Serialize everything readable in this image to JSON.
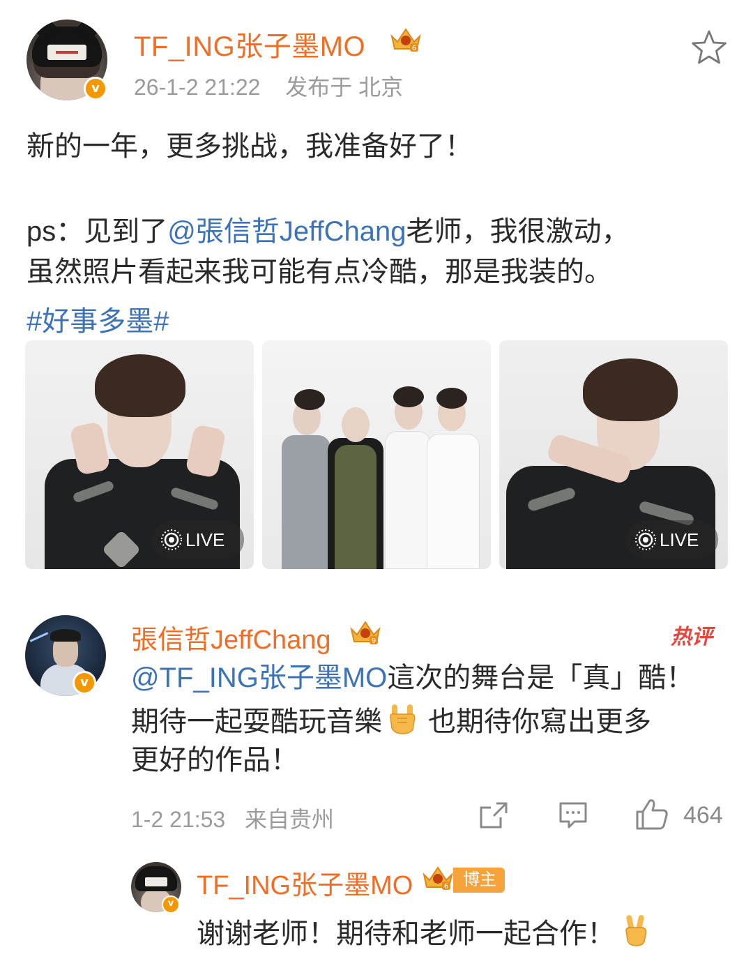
{
  "post": {
    "author": "TF_ING张子墨MO",
    "timestamp": "26-1-2 21:22",
    "location": "发布于 北京",
    "text_line1": "新的一年，更多挑战，我准备好了！",
    "text_line2_prefix": "ps：见到了",
    "text_line2_mention": "@張信哲JeffChang",
    "text_line2_suffix": "老师，我很激动，",
    "text_line3": "虽然照片看起来我可能有点冷酷，那是我装的。",
    "hashtag": "#好事多墨#",
    "photos": [
      {
        "live_label": "LIVE"
      },
      {
        "live_label": ""
      },
      {
        "live_label": "LIVE"
      }
    ]
  },
  "comment": {
    "author": "張信哲JeffChang",
    "hot_tag": "热评",
    "mention": "@TF_ING张子墨MO",
    "text_line1_suffix": "這次的舞台是「真」酷！",
    "text_line2": "期待一起耍酷玩音樂",
    "text_line2_after_emoji": "也期待你寫出更多",
    "text_line3": "更好的作品！",
    "timestamp": "1-2 21:53",
    "source": "来自贵州",
    "like_count": "464"
  },
  "reply": {
    "author": "TF_ING张子墨MO",
    "badge": "博主",
    "text": "谢谢老师！期待和老师一起合作！"
  },
  "colors": {
    "username": "#f26d24",
    "link": "#3b72b8",
    "meta": "#9a9a9a",
    "verified": "#f39800",
    "hot": "#e8453c"
  },
  "icons": {
    "favorite": "star-outline-icon",
    "repost": "share-icon",
    "comment": "comment-icon",
    "like": "thumbs-up-icon",
    "live": "live-photo-icon",
    "crown": "crown-badge-icon"
  }
}
